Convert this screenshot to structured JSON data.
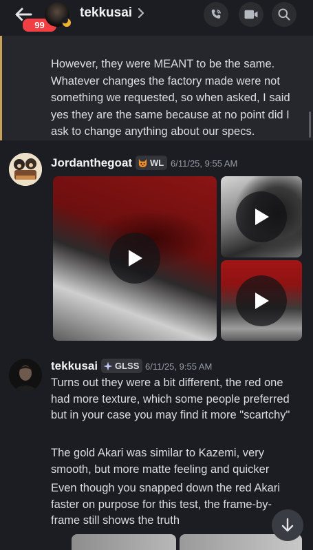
{
  "header": {
    "channel_name": "tekkusai",
    "unread_count": "99",
    "icons": {
      "back": "arrow-left-icon",
      "status": "moon-idle-icon",
      "chevron": "chevron-right-icon",
      "call": "phone-icon",
      "video": "video-camera-icon",
      "search": "search-icon"
    }
  },
  "quoted_message": {
    "text": "However, they were MEANT to be the same. Whatever changes the factory made were not something we requested, so when asked, I said yes they are the same because at no point did I ask to change anything about our specs."
  },
  "messages": [
    {
      "author": "Jordanthegoat",
      "tag": "WL",
      "tag_icon": "cat-face-icon",
      "timestamp": "6/11/25, 9:55 AM",
      "attachments": [
        {
          "type": "video",
          "icon": "play-icon"
        },
        {
          "type": "video",
          "icon": "play-icon"
        },
        {
          "type": "video",
          "icon": "play-icon"
        }
      ]
    },
    {
      "author": "tekkusai",
      "tag": "GLSS",
      "tag_icon": "sparkle-icon",
      "timestamp": "6/11/25, 9:55 AM",
      "paragraphs": [
        "Turns out they were a bit different, the red one had more texture, which some people preferred but in your case you may find it more \"scartchy\"",
        "The gold Akari was similar to Kazemi, very smooth, but more matte feeling and quicker",
        "Even though you snapped down the red Akari faster on purpose for this test, the frame-by-frame still shows the truth"
      ]
    }
  ],
  "jump_button": {
    "icon": "arrow-down-icon"
  },
  "colors": {
    "background": "#1c1d22",
    "quote_background": "#26272c",
    "quote_border": "#c7a05a",
    "unread_badge": "#f23f43",
    "status_idle": "#f0b232"
  }
}
